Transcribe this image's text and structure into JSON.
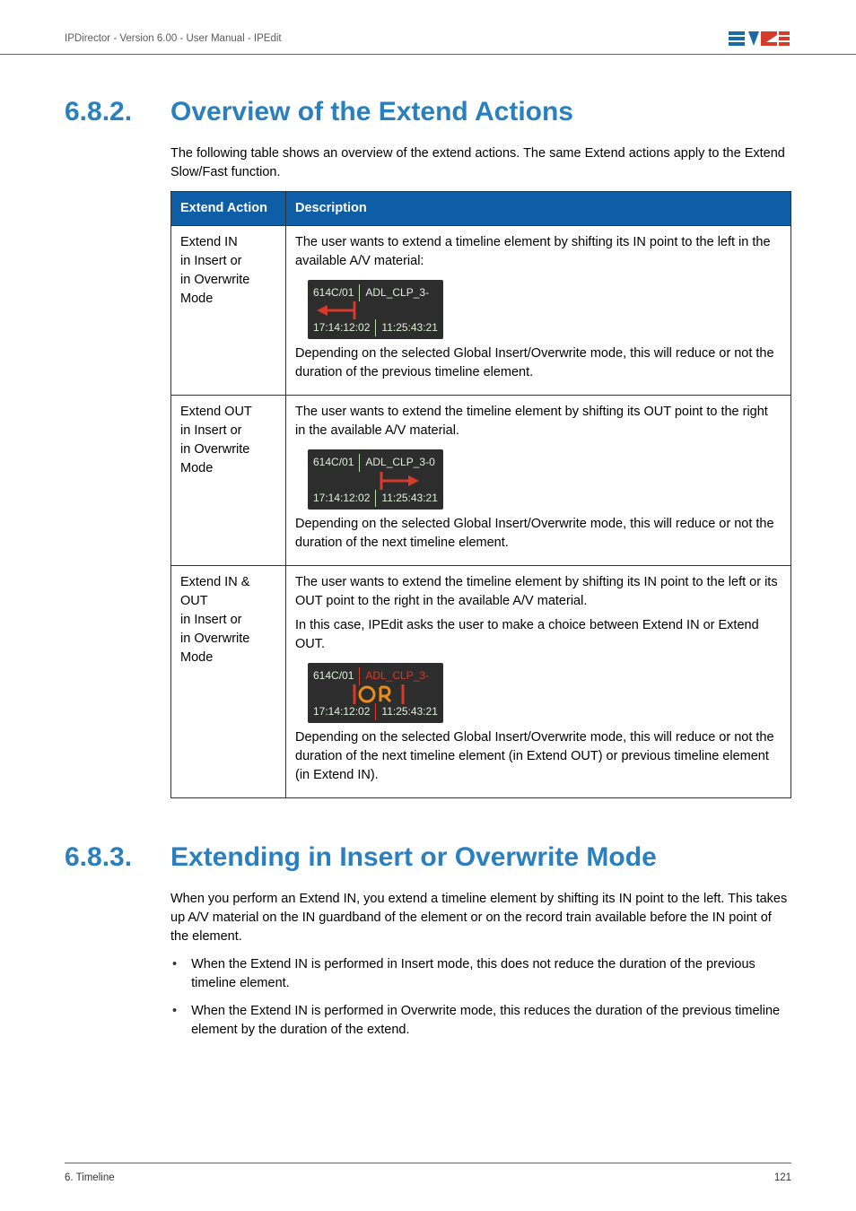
{
  "header": {
    "breadcrumb": "IPDirector - Version 6.00 - User Manual - IPEdit"
  },
  "section1": {
    "number": "6.8.2.",
    "title": "Overview of the Extend Actions",
    "intro": "The following table shows an overview of the extend actions. The same Extend actions apply to the Extend Slow/Fast function.",
    "table": {
      "head_action": "Extend Action",
      "head_desc": "Description",
      "rows": [
        {
          "action": "Extend IN\nin Insert or\nin Overwrite Mode",
          "p1": "The user wants to extend a timeline element by shifting its IN point to the left in the available A/V material:",
          "clip_left": "614C/01",
          "clip_right": "ADL_CLP_3-",
          "tc_left": "17:14:12:02",
          "tc_right": "11:25:43:21",
          "arrow": "left",
          "p2": "Depending on the selected Global Insert/Overwrite mode, this will reduce or not the duration of the previous timeline element."
        },
        {
          "action": "Extend OUT\nin Insert or\nin Overwrite Mode",
          "p1": "The user wants to extend the timeline element by shifting its OUT point to the right in the available A/V material.",
          "clip_left": "614C/01",
          "clip_right": "ADL_CLP_3-0",
          "tc_left": "17:14:12:02",
          "tc_right": "11:25:43:21",
          "arrow": "right",
          "p2": "Depending on the selected Global Insert/Overwrite mode, this will reduce or not the duration of the next timeline element."
        },
        {
          "action": "Extend IN & OUT\nin Insert or\nin Overwrite Mode",
          "p1a": "The user wants to extend the timeline element by shifting its IN point to the left or its OUT point to the right in the available A/V material.",
          "p1b": "In this case, IPEdit asks the user to make a choice between Extend IN or Extend OUT.",
          "clip_left": "614C/01",
          "clip_right": "ADL_CLP_3-",
          "tc_left": "17:14:12:02",
          "tc_right": "11:25:43:21",
          "arrow": "or",
          "p2": "Depending on the selected Global Insert/Overwrite mode, this will reduce or not the duration of the next timeline element (in Extend OUT) or previous timeline element (in Extend IN)."
        }
      ]
    }
  },
  "section2": {
    "number": "6.8.3.",
    "title": "Extending in Insert or Overwrite Mode",
    "para": "When you perform an Extend IN, you extend a timeline element by shifting its IN point to the left. This takes up A/V material on the IN guardband of the element or on the record train available before the IN point of the element.",
    "bullets": [
      "When the Extend IN is performed in Insert mode, this does not reduce the duration of the previous timeline element.",
      "When the Extend IN is performed in Overwrite mode, this reduces the duration of the previous timeline element by the duration of the extend."
    ]
  },
  "footer": {
    "left": "6. Timeline",
    "right": "121"
  }
}
